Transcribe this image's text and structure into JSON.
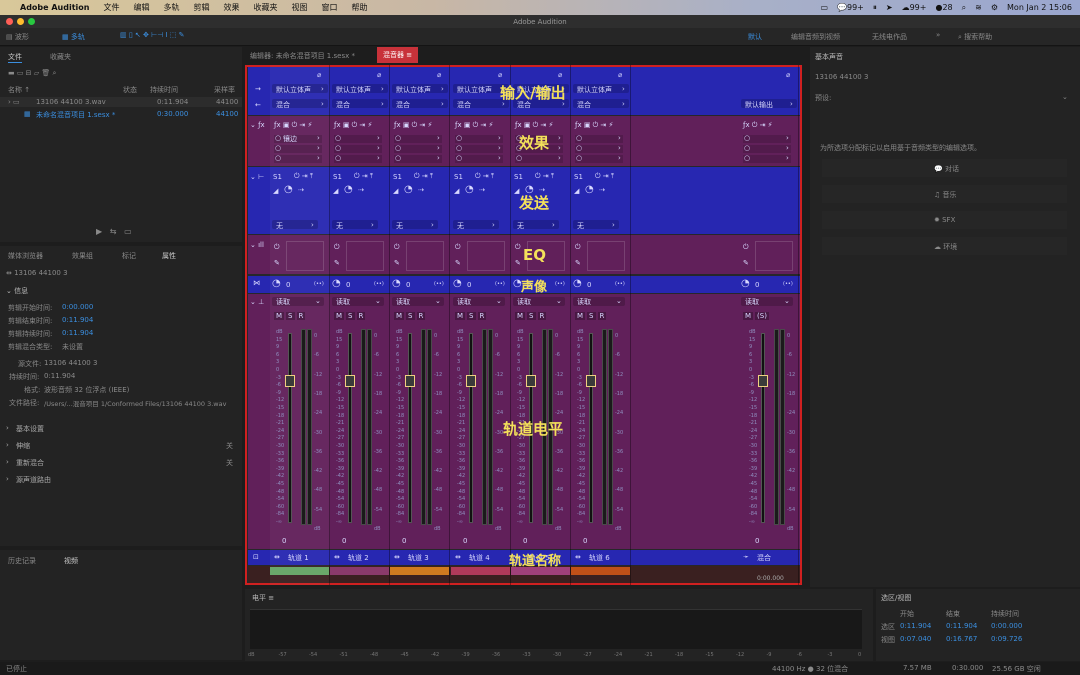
{
  "menubar": {
    "app": "Adobe Audition",
    "items": [
      "文件",
      "编辑",
      "多轨",
      "剪辑",
      "效果",
      "收藏夹",
      "视图",
      "窗口",
      "帮助"
    ],
    "status_wechat": "99+",
    "status_msg": "99+",
    "status_num": "28",
    "datetime": "Mon Jan 2  15:06"
  },
  "window": {
    "title": "Adobe Audition"
  },
  "toolbar": {
    "waveform": "波形",
    "multitrack": "多轨",
    "workspace_default": "默认",
    "workspace_edit_video": "编辑音频到视频",
    "workspace_wireless": "无线电作品",
    "search_placeholder": "搜索帮助"
  },
  "files_panel": {
    "tab_files": "文件",
    "tab_favorites": "收藏夹",
    "col_name": "名称 ↑",
    "col_status": "状态",
    "col_duration": "持续时间",
    "col_rate": "采样率",
    "rows": [
      {
        "name": "13106 44100 3.wav",
        "dur": "0:11.904",
        "rate": "44100"
      },
      {
        "name": "未命名混音项目 1.sesx *",
        "dur": "0:30.000",
        "rate": "44100"
      }
    ]
  },
  "bottom_tabs": {
    "media": "媒体浏览器",
    "effects": "效果组",
    "markers": "标记",
    "props": "属性"
  },
  "props": {
    "file": "13106 44100 3",
    "info": "信息",
    "rows": [
      {
        "k": "剪辑开始时间:",
        "v": "0:00.000"
      },
      {
        "k": "剪辑结束时间:",
        "v": "0:11.904"
      },
      {
        "k": "剪辑持续时间:",
        "v": "0:11.904"
      },
      {
        "k": "剪辑混合类型:",
        "v": "未设置"
      }
    ],
    "src_label": "源文件:",
    "src": "13106 44100 3",
    "dur_label": "持续时间:",
    "dur": "0:11.904",
    "fmt_label": "格式:",
    "fmt": "波形音频 32 位浮点 (IEEE)",
    "path_label": "文件路径:",
    "path": "/Users/...混音项目 1/Conformed Files/13106 44100 3.wav",
    "sections": [
      {
        "name": "基本设置",
        "v": ""
      },
      {
        "name": "伸缩",
        "v": "关"
      },
      {
        "name": "重新混合",
        "v": "关"
      },
      {
        "name": "源声道路由",
        "v": ""
      }
    ]
  },
  "history": {
    "tab": "历史记录",
    "video": "视频"
  },
  "editor_tabs": {
    "editor": "编辑器: 未命名混音项目 1.sesx *",
    "mixer": "混音器"
  },
  "essential": {
    "title": "基本声音",
    "file": "13106 44100 3",
    "preset": "预设:",
    "hint": "为所选项分配标记以启用基于音频类型的编辑选项。",
    "buttons": [
      "对话",
      "音乐",
      "SFX",
      "环境"
    ]
  },
  "mixer": {
    "tracks": [
      {
        "in": "默认立体声",
        "out": "混合",
        "send": "S1",
        "send_dest": "无",
        "name": "轨道 1",
        "vol": "0",
        "pan": "0",
        "fx": "镶边",
        "read": "读取",
        "color": "#6aa86a"
      },
      {
        "in": "默认立体声",
        "out": "混合",
        "send": "S1",
        "send_dest": "无",
        "name": "轨道 2",
        "vol": "0",
        "pan": "0",
        "fx": "",
        "read": "读取",
        "color": "#8a3a6a"
      },
      {
        "in": "默认立体声",
        "out": "混合",
        "send": "S1",
        "send_dest": "无",
        "name": "轨道 3",
        "vol": "0",
        "pan": "0",
        "fx": "",
        "read": "读取",
        "color": "#d07a20"
      },
      {
        "in": "默认立体声",
        "out": "混合",
        "send": "S1",
        "send_dest": "无",
        "name": "轨道 4",
        "vol": "0",
        "pan": "0",
        "fx": "",
        "read": "读取",
        "color": "#b03a5a"
      },
      {
        "in": "默认立体声",
        "out": "混合",
        "send": "S1",
        "send_dest": "无",
        "name": "轨道 5",
        "vol": "0",
        "pan": "0",
        "fx": "",
        "read": "读取",
        "color": "#a0407a"
      },
      {
        "in": "默认立体声",
        "out": "混合",
        "send": "S1",
        "send_dest": "无",
        "name": "轨道 6",
        "vol": "0",
        "pan": "0",
        "fx": "",
        "read": "读取",
        "color": "#c05018"
      }
    ],
    "master": {
      "out": "默认输出",
      "name": "混合",
      "vol": "0",
      "pan": "0",
      "read": "读取"
    },
    "fader_ticks": [
      "dB",
      "15",
      "9",
      "6",
      "3",
      "0",
      "-3",
      "-6",
      "-9",
      "-12",
      "-15",
      "-18",
      "-21",
      "-24",
      "-27",
      "-30",
      "-33",
      "-36",
      "-39",
      "-42",
      "-45",
      "-48",
      "-54",
      "-60",
      "-84",
      "-∞"
    ],
    "meter_ticks": [
      "0",
      "-6",
      "-12",
      "-18",
      "-24",
      "-30",
      "-36",
      "-42",
      "-48",
      "-54",
      "dB"
    ],
    "msr": [
      "M",
      "S",
      "R"
    ],
    "time": "0:00.000",
    "labels": {
      "io": "输入/输出",
      "fx": "效果",
      "sends": "发送",
      "eq": "EQ",
      "pan": "声像",
      "level": "轨道电平",
      "names": "轨道名称"
    }
  },
  "level": {
    "title": "电平",
    "ticks": [
      "dB",
      "-57",
      "-54",
      "-51",
      "-48",
      "-45",
      "-42",
      "-39",
      "-36",
      "-33",
      "-30",
      "-27",
      "-24",
      "-21",
      "-18",
      "-15",
      "-12",
      "-9",
      "-6",
      "-3",
      "0"
    ]
  },
  "selection": {
    "title": "选区/视图",
    "col_start": "开始",
    "col_end": "结束",
    "col_dur": "持续时间",
    "rows": [
      {
        "k": "选区",
        "s": "0:11.904",
        "e": "0:11.904",
        "d": "0:00.000"
      },
      {
        "k": "视图",
        "s": "0:07.040",
        "e": "0:16.767",
        "d": "0:09.726"
      }
    ]
  },
  "status": {
    "left": "已停止",
    "rate": "44100 Hz ● 32 位混合",
    "mem": "7.57 MB",
    "time": "0:30.000",
    "disk": "25.56 GB 空闲"
  }
}
